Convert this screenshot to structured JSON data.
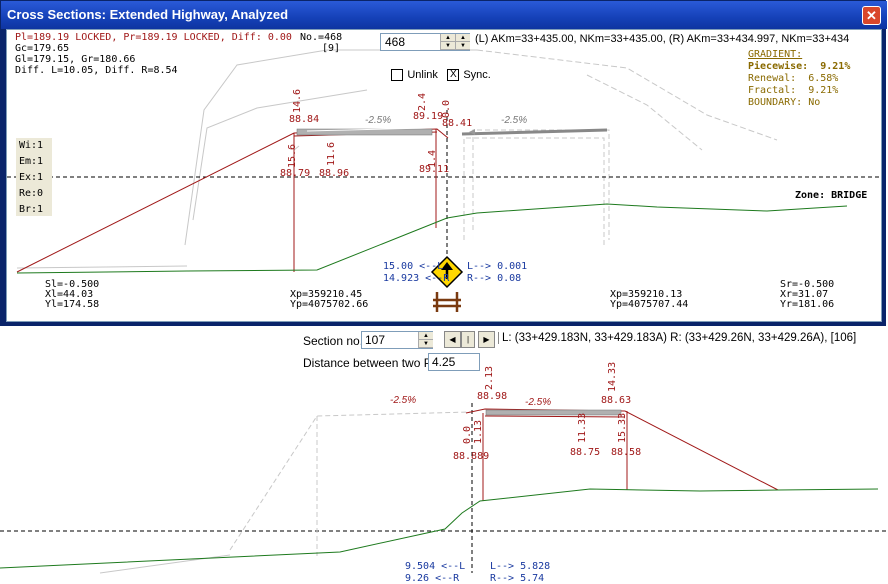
{
  "window": {
    "title": "Cross Sections: Extended Highway, Analyzed",
    "close_glyph": "✕"
  },
  "top": {
    "line1": "Pl=189.19 LOCKED, Pr=189.19 LOCKED, Diff: 0.00",
    "line2": "Gc=179.65",
    "line3": "Gl=179.15, Gr=180.66",
    "line4": "Diff. L=10.05, Diff. R=8.54",
    "no_label": "No.=468",
    "no_sub": "[9]",
    "section_value": "468",
    "station_info": "(L) AKm=33+435.00, NKm=33+435.00, (R) AKm=33+434.997, NKm=33+434",
    "unlink_label": "Unlink",
    "sync_label": "Sync.",
    "sync_checked": "X",
    "legend": [
      "Wi:1",
      "Em:1",
      "Ex:1",
      "Re:0",
      "Br:1"
    ],
    "gradient": {
      "title": "GRADIENT:",
      "piecewise": "Piecewise:  9.21%",
      "renewal": "Renewal:  6.58%",
      "fractal": "Fractal:  9.21%",
      "boundary": "BOUNDARY: No"
    },
    "zone": "Zone: BRIDGE",
    "slope_left": "-2.5%",
    "slope_right": "-2.5%",
    "labels": {
      "l1": "14.6",
      "l2": "88.84",
      "l3": "2.4",
      "l4": "89.19",
      "l5": "0.0",
      "l6": "88.41",
      "l7": "15.6",
      "l8": "11.6",
      "l9": "1.4",
      "l10": "88.79",
      "l11": "88.96",
      "l12": "89.11"
    },
    "offsets": {
      "left1": "15.00 <--L",
      "left2": "14.923 <--R",
      "right1": "L--> 0.001",
      "right2": "R--> 0.08"
    },
    "sl": "Sl=-0.500",
    "xl": "Xl=44.03",
    "yl": "Yl=174.58",
    "xp1": "Xp=359210.45",
    "yp1": "Yp=4075702.66",
    "xp2": "Xp=359210.13",
    "yp2": "Yp=4075707.44",
    "sr": "Sr=-0.500",
    "xr": "Xr=31.07",
    "yr": "Yr=181.06"
  },
  "bottom": {
    "section_label": "Section no.:",
    "section_value": "107",
    "station_info": "L: (33+429.183N, 33+429.183A) R: (33+429.26N, 33+429.26A), [106]",
    "distance_label": "Distance between two PL:",
    "distance_value": "4.25",
    "slope_left": "-2.5%",
    "slope_mid": "-2.5%",
    "labels": {
      "b1": "2.13",
      "b2": "88.98",
      "b3": "14.33",
      "b4": "88.63",
      "b5": "0.0",
      "b6": "1.13",
      "b7": "88.889",
      "b8": "11.33",
      "b9": "15.33",
      "b10": "88.75",
      "b11": "88.58"
    },
    "offsets": {
      "left1": "9.504 <--L",
      "left2": "9.26 <--R",
      "right1": "L--> 5.828",
      "right2": "R--> 5.74"
    }
  },
  "colors": {
    "accent_red": "#a01818",
    "ground_green": "#1e7a1e",
    "info_blue": "#1a3aa0",
    "gradient_olive": "#8a6a00"
  }
}
